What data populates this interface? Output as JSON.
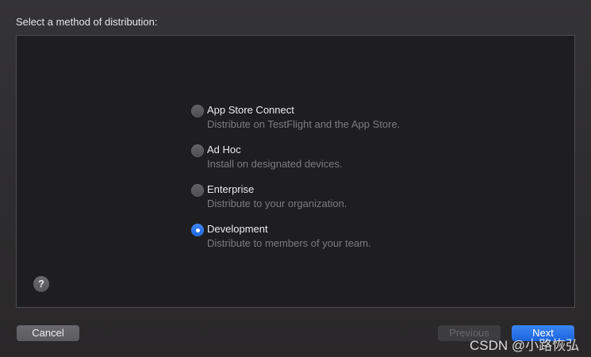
{
  "dialog": {
    "prompt": "Select a method of distribution:"
  },
  "options": [
    {
      "title": "App Store Connect",
      "description": "Distribute on TestFlight and the App Store.",
      "selected": false
    },
    {
      "title": "Ad Hoc",
      "description": "Install on designated devices.",
      "selected": false
    },
    {
      "title": "Enterprise",
      "description": "Distribute to your organization.",
      "selected": false
    },
    {
      "title": "Development",
      "description": "Distribute to members of your team.",
      "selected": true
    }
  ],
  "help": {
    "label": "?"
  },
  "buttons": {
    "cancel": "Cancel",
    "previous": "Previous",
    "next": "Next"
  },
  "watermark": "CSDN @小路恢弘",
  "colors": {
    "accent": "#2e7bf0",
    "panel_background": "#1e1e20",
    "window_background": "#2d2c2e"
  }
}
